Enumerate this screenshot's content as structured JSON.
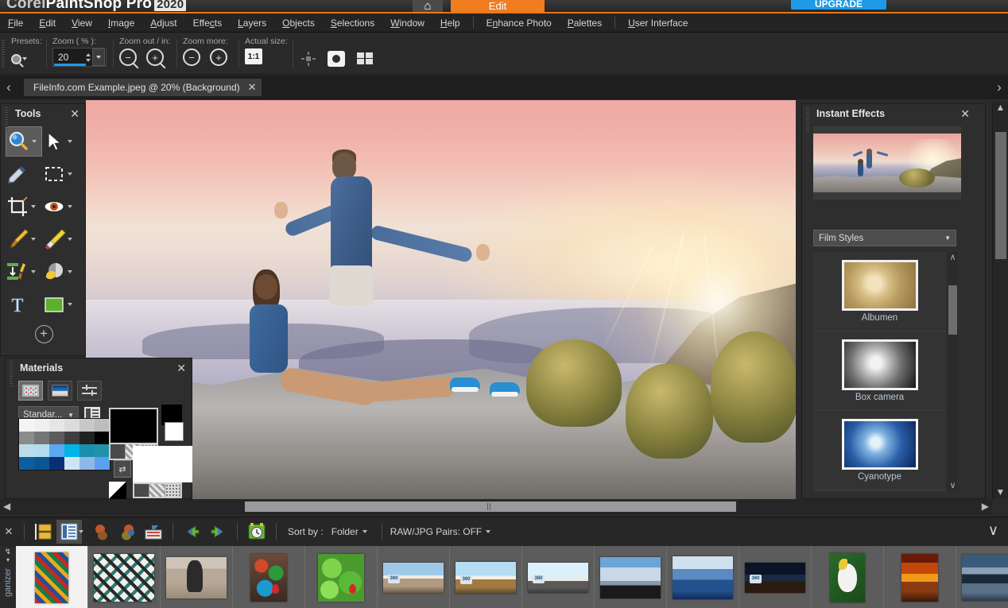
{
  "titlebar": {
    "brand_part1": "Corel",
    "brand_part2": "PaintShop Pro",
    "brand_year": "2020",
    "home_icon": "home-icon",
    "edit_tab": "Edit",
    "upgrade_button": "UPGRADE"
  },
  "menubar": {
    "items": [
      {
        "label": "File",
        "accel": "F"
      },
      {
        "label": "Edit",
        "accel": "E"
      },
      {
        "label": "View",
        "accel": "V"
      },
      {
        "label": "Image",
        "accel": "I"
      },
      {
        "label": "Adjust",
        "accel": "A"
      },
      {
        "label": "Effects",
        "accel": "c"
      },
      {
        "label": "Layers",
        "accel": "L"
      },
      {
        "label": "Objects",
        "accel": "O"
      },
      {
        "label": "Selections",
        "accel": "S"
      },
      {
        "label": "Window",
        "accel": "W"
      },
      {
        "label": "Help",
        "accel": "H"
      }
    ],
    "right_items": [
      {
        "label": "Enhance Photo"
      },
      {
        "label": "Palettes"
      },
      {
        "label": "User Interface"
      }
    ]
  },
  "optionsbar": {
    "presets_label": "Presets:",
    "zoom_label": "Zoom ( % ):",
    "zoom_value": "20",
    "zoomout_label": "Zoom out / in:",
    "zoommore_label": "Zoom more:",
    "actualsize_label": "Actual size:",
    "actualsize_glyph": "1:1",
    "minus": "−",
    "plus": "+"
  },
  "tabbar": {
    "prev_arrow": "‹",
    "next_arrow": "›",
    "document_tab": "FileInfo.com Example.jpeg @  20% (Background)",
    "close_glyph": "✕"
  },
  "tools": {
    "title": "Tools",
    "close_glyph": "✕",
    "items": [
      {
        "name": "zoom-tool",
        "selected": true
      },
      {
        "name": "pick-tool",
        "selected": false
      },
      {
        "name": "dropper-tool",
        "selected": false
      },
      {
        "name": "selection-tool",
        "selected": false
      },
      {
        "name": "crop-tool",
        "selected": false
      },
      {
        "name": "red-eye-tool",
        "selected": false
      },
      {
        "name": "paint-brush-tool",
        "selected": false
      },
      {
        "name": "eraser-tool",
        "selected": false
      },
      {
        "name": "clone-tool",
        "selected": false
      },
      {
        "name": "color-changer-tool",
        "selected": false
      },
      {
        "name": "text-tool",
        "selected": false
      },
      {
        "name": "preset-shape-tool",
        "selected": false
      }
    ],
    "add_tool_glyph": "+"
  },
  "materials": {
    "title": "Materials",
    "close_glyph": "✕",
    "tabs": [
      "frame-tab",
      "rainbow-tab",
      "swatches-tab"
    ],
    "active_tab_index": 0,
    "select_value": "Standar...",
    "select_caret": "▼",
    "swatch_colors": [
      "#f4f4f4",
      "#efefef",
      "#e6e6e6",
      "#dcdcdc",
      "#c8c8c8",
      "#bdbdbd",
      "#8c8c8c",
      "#757575",
      "#5c5c5c",
      "#3f3f3f",
      "#222222",
      "#000000",
      "#bcdcea",
      "#b4dcee",
      "#5aa8f0",
      "#00b4e6",
      "#1a8fb0",
      "#1f93a8",
      "#0e5e9e",
      "#0b5593",
      "#0a2f73",
      "#cfe4f2",
      "#8fb8e6",
      "#5aa0f0"
    ],
    "foreground_color": "#000000",
    "background_color": "#ffffff"
  },
  "instant_effects": {
    "title": "Instant Effects",
    "close_glyph": "✕",
    "category_value": "Film Styles",
    "category_caret": "▼",
    "items": [
      {
        "label": "Albumen"
      },
      {
        "label": "Box camera"
      },
      {
        "label": "Cyanotype"
      }
    ],
    "scroll_up_glyph": "∧",
    "scroll_down_glyph": "∨"
  },
  "organizer": {
    "close_glyph": "✕",
    "rail_label": "ganizer",
    "rail_pin_glyph": "↯",
    "rail_caret": "▾",
    "buttons": [
      {
        "name": "show-folders-button"
      },
      {
        "name": "show-info-button"
      },
      {
        "name": "rotate-left-photo-button"
      },
      {
        "name": "rotate-right-photo-button"
      },
      {
        "name": "share-button"
      },
      {
        "name": "undo-button"
      },
      {
        "name": "redo-button"
      },
      {
        "name": "recent-button"
      }
    ],
    "sortby_label": "Sort by :",
    "sortby_value": "Folder",
    "sortby_caret": "▾",
    "rawjpg_label": "RAW/JPG Pairs: OFF",
    "rawjpg_caret": "▾",
    "collapse_glyph": "∨",
    "thumbnails": [
      {
        "name": "thumb-kilim-pattern",
        "selected": true
      },
      {
        "name": "thumb-tile-mosaic",
        "selected": false
      },
      {
        "name": "thumb-cat-street",
        "selected": false
      },
      {
        "name": "thumb-market-produce",
        "selected": false
      },
      {
        "name": "thumb-green-leaves",
        "selected": false
      },
      {
        "name": "thumb-360-desert",
        "selected": false
      },
      {
        "name": "thumb-360-canyon",
        "selected": false
      },
      {
        "name": "thumb-360-plateau",
        "selected": false
      },
      {
        "name": "thumb-mountain-clouds",
        "selected": false
      },
      {
        "name": "thumb-city-blue",
        "selected": false
      },
      {
        "name": "thumb-360-night-harbor",
        "selected": false
      },
      {
        "name": "thumb-cockatoo",
        "selected": false
      },
      {
        "name": "thumb-sunset-field",
        "selected": false
      },
      {
        "name": "thumb-lake-dusk",
        "selected": false
      }
    ]
  },
  "canvas": {
    "image_name": "FileInfo.com Example.jpeg",
    "zoom_percent": "20%",
    "layer": "Background"
  }
}
